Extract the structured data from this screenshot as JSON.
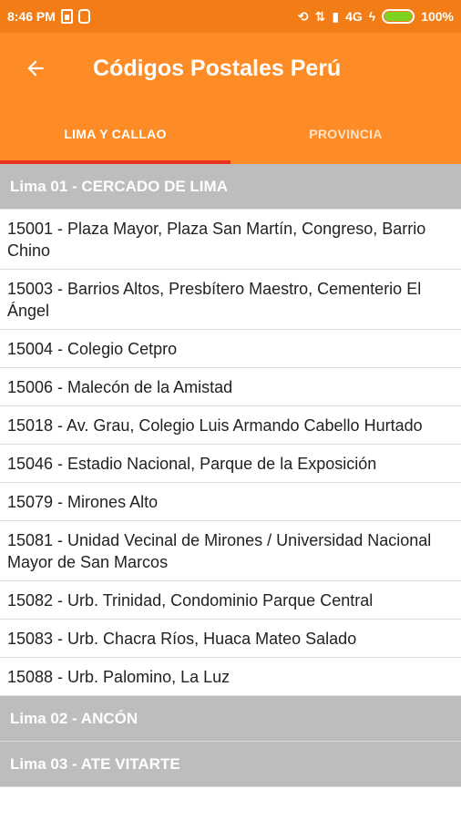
{
  "status_bar": {
    "time": "8:46 PM",
    "network": "4G",
    "battery_percent": "100%",
    "battery_level": 1.0
  },
  "app_bar": {
    "title": "Códigos Postales Perú",
    "back_icon": "arrow-left-icon"
  },
  "tabs": [
    {
      "label": "LIMA Y CALLAO",
      "active": true
    },
    {
      "label": "PROVINCIA",
      "active": false
    }
  ],
  "colors": {
    "status_bar": "#f27d16",
    "app_bar": "#fd8c26",
    "tab_indicator": "#e8321e",
    "section_header": "#bdbdbd"
  },
  "sections": [
    {
      "header": "Lima 01 - CERCADO DE LIMA",
      "items": [
        "15001 - Plaza Mayor, Plaza San Martín, Congreso, Barrio Chino",
        "15003 - Barrios Altos, Presbítero Maestro, Cementerio El Ángel",
        "15004 - Colegio Cetpro",
        "15006 - Malecón de la Amistad",
        "15018 - Av. Grau, Colegio Luis Armando Cabello Hurtado",
        "15046 - Estadio Nacional, Parque de la Exposición",
        "15079 - Mirones Alto",
        "15081 - Unidad Vecinal de Mirones / Universidad Nacional Mayor de San Marcos",
        "15082 - Urb. Trinidad, Condominio Parque Central",
        "15083 - Urb. Chacra Ríos, Huaca Mateo Salado",
        "15088 - Urb. Palomino, La Luz"
      ]
    },
    {
      "header": "Lima 02 - ANCÓN",
      "items": []
    },
    {
      "header": "Lima 03 - ATE VITARTE",
      "items": []
    }
  ]
}
